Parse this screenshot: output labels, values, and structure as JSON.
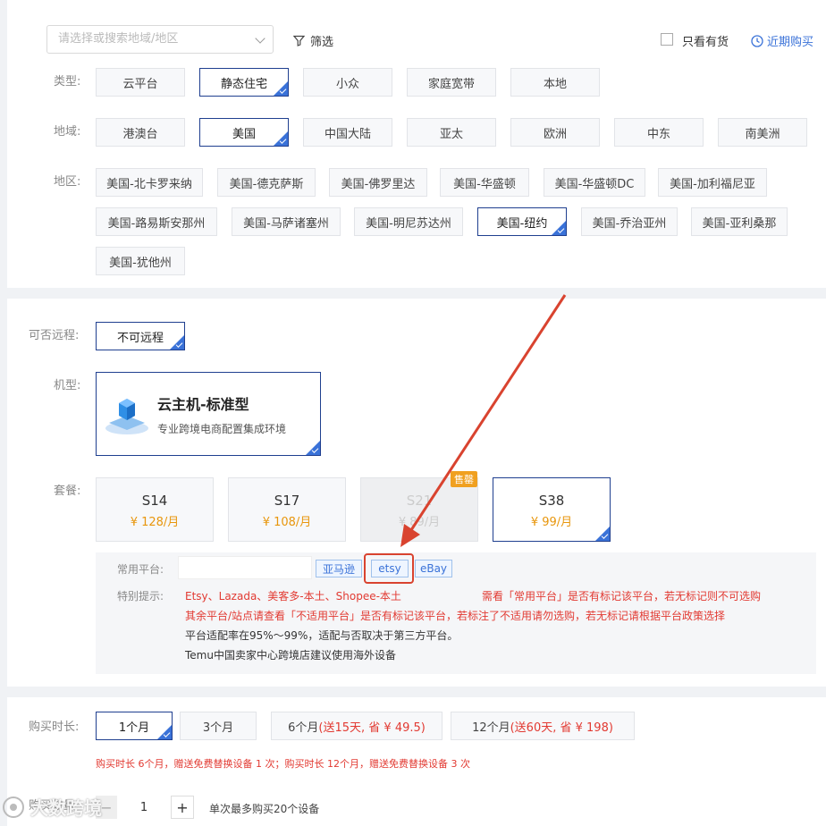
{
  "filterbar": {
    "search_placeholder": "请选择或搜索地域/地区",
    "filter_label": "筛选",
    "in_stock_label": "只看有货",
    "recent_label": "近期购买"
  },
  "type": {
    "label": "类型:",
    "options": [
      "云平台",
      "静态住宅",
      "小众",
      "家庭宽带",
      "本地"
    ],
    "selected": "静态住宅"
  },
  "region": {
    "label": "地域:",
    "options": [
      "港澳台",
      "美国",
      "中国大陆",
      "亚太",
      "欧洲",
      "中东",
      "南美洲"
    ],
    "selected": "美国"
  },
  "area": {
    "label": "地区:",
    "options": [
      "美国-北卡罗来纳",
      "美国-德克萨斯",
      "美国-佛罗里达",
      "美国-华盛顿",
      "美国-华盛顿DC",
      "美国-加利福尼亚",
      "美国-路易斯安那州",
      "美国-马萨诸塞州",
      "美国-明尼苏达州",
      "美国-纽约",
      "美国-乔治亚州",
      "美国-亚利桑那",
      "美国-犹他州"
    ],
    "selected": "美国-纽约"
  },
  "remote": {
    "label": "可否远程:",
    "option": "不可远程"
  },
  "model": {
    "label": "机型:",
    "title": "云主机-标准型",
    "desc": "专业跨境电商配置集成环境"
  },
  "plans": {
    "label": "套餐:",
    "items": [
      {
        "code": "S14",
        "price": "¥ 128/月",
        "state": "normal"
      },
      {
        "code": "S17",
        "price": "¥ 108/月",
        "state": "normal"
      },
      {
        "code": "S21",
        "price": "¥ 89/月",
        "state": "disabled",
        "badge": "售罄"
      },
      {
        "code": "S38",
        "price": "¥ 99/月",
        "state": "selected"
      }
    ]
  },
  "platform": {
    "label": "常用平台:",
    "tags": [
      "亚马逊",
      "etsy",
      "eBay"
    ],
    "tip_label": "特别提示:",
    "tip_line1_red": "Etsy、Lazada、美客多-本土、Shopee-本土",
    "tip_line1_red2": "需看「常用平台」是否有标记该平台，若无标记则不可选购",
    "tip_line2": "其余平台/站点请查看「不适用平台」是否有标记该平台，若标注了不适用请勿选购，若无标记请根据平台政策选择",
    "tip_line3": "平台适配率在95%～99%，适配与否取决于第三方平台。",
    "tip_line4": "Temu中国卖家中心跨境店建议使用海外设备"
  },
  "duration": {
    "label": "购买时长:",
    "options": [
      {
        "text": "1个月",
        "bonus": ""
      },
      {
        "text": "3个月",
        "bonus": ""
      },
      {
        "text": "6个月",
        "bonus": "(送15天, 省 ¥ 49.5)"
      },
      {
        "text": "12个月",
        "bonus": "(送60天, 省 ¥ 198)"
      }
    ],
    "selected": "1个月",
    "note": "购买时长 6个月，赠送免费替换设备 1 次；购买时长 12个月，赠送免费替换设备 3 次"
  },
  "quantity": {
    "label": "购买数量:",
    "minus": "−",
    "value": "1",
    "plus": "+",
    "hint": "单次最多购买20个设备"
  },
  "watermark": "大数跨境",
  "colors": {
    "accent": "#3a72d8",
    "selected_border": "#1f3f8f",
    "price": "#e8960c",
    "warning": "#e23a32",
    "annotation": "#d9432f"
  }
}
